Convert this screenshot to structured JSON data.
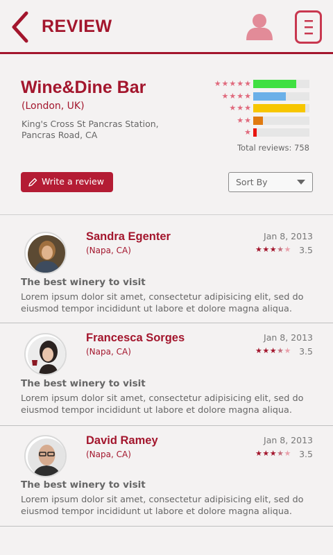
{
  "header": {
    "title": "REVIEW",
    "back_icon": "chevron-left-icon",
    "profile_icon": "user-icon",
    "menu_icon": "menu-icon",
    "accent_color": "#a3162d"
  },
  "venue": {
    "name": "Wine&Dine Bar",
    "city": "(London, UK)",
    "address_line1": "King's Cross St Pancras Station,",
    "address_line2": "Pancras Road, CA"
  },
  "ratings": {
    "rows": [
      {
        "stars": "★★★★★",
        "fraction": 0.76,
        "color": "#3fe041"
      },
      {
        "stars": "★★★★",
        "fraction": 0.58,
        "color": "#6bb0e8"
      },
      {
        "stars": "★★★",
        "fraction": 0.93,
        "color": "#f7c600"
      },
      {
        "stars": "★★",
        "fraction": 0.17,
        "color": "#e07a10"
      },
      {
        "stars": "★",
        "fraction": 0.06,
        "color": "#e8140e"
      }
    ],
    "total": "Total reviews: 758"
  },
  "actions": {
    "write_review": "Write a review",
    "write_icon": "pencil-icon",
    "sort_label": "Sort By",
    "sort_icon": "caret-down-icon"
  },
  "reviews": [
    {
      "name": "Sandra Egenter",
      "location": "(Napa, CA)",
      "date": "Jan 8, 2013",
      "rating": 3.5,
      "stars_on": "★★★",
      "stars_half": "★",
      "stars_off": "★",
      "score": "3.5",
      "title": "The best winery to visit",
      "body": "Lorem ipsum dolor sit amet, consectetur adipisicing elit, sed do eiusmod tempor incididunt ut labore et dolore magna aliqua."
    },
    {
      "name": "Francesca Sorges",
      "location": "(Napa, CA)",
      "date": "Jan 8, 2013",
      "rating": 3.5,
      "stars_on": "★★★",
      "stars_half": "★",
      "stars_off": "★",
      "score": "3.5",
      "title": "The best winery to visit",
      "body": "Lorem ipsum dolor sit amet, consectetur adipisicing elit, sed do eiusmod tempor incididunt ut labore et dolore magna aliqua."
    },
    {
      "name": "David Ramey",
      "location": "(Napa, CA)",
      "date": "Jan 8, 2013",
      "rating": 3.5,
      "stars_on": "★★★",
      "stars_half": "★",
      "stars_off": "★",
      "score": "3.5",
      "title": "The best winery to visit",
      "body": "Lorem ipsum dolor sit amet, consectetur adipisicing elit, sed do eiusmod tempor incididunt ut labore et dolore magna aliqua."
    }
  ]
}
